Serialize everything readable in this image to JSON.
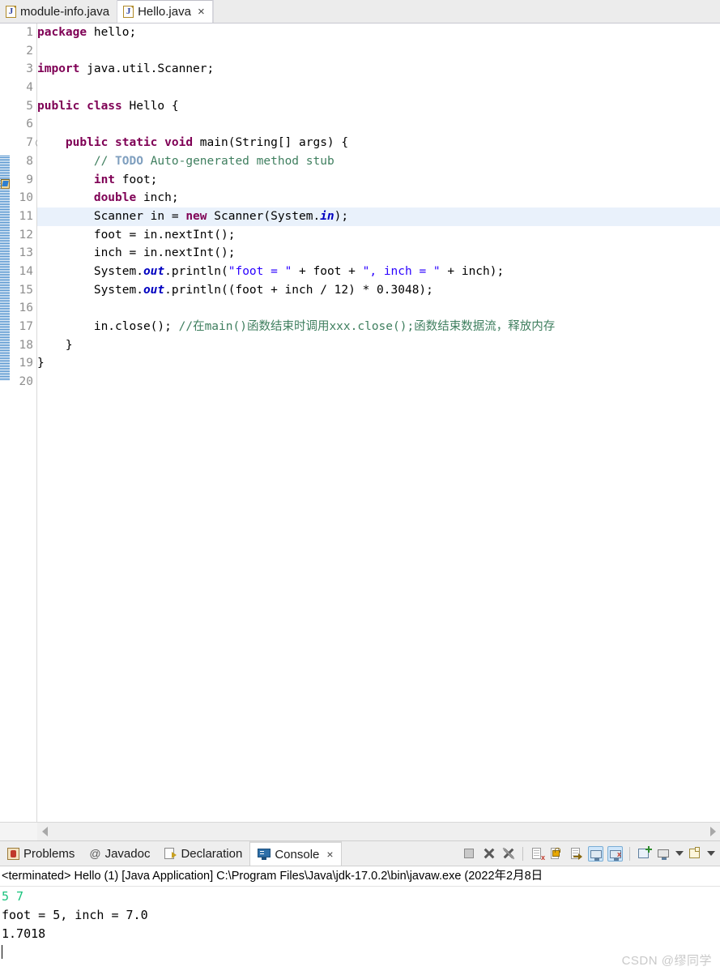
{
  "editor_tabs": [
    {
      "label": "module-info.java",
      "icon": "java-file-icon",
      "active": false,
      "closable": false
    },
    {
      "label": "Hello.java",
      "icon": "java-file-icon",
      "active": true,
      "closable": true,
      "close_glyph": "×"
    }
  ],
  "editor": {
    "highlighted_line": 11,
    "fold_line": 7,
    "todo_marker_line": 8,
    "line_numbers": [
      "1",
      "2",
      "3",
      "4",
      "5",
      "6",
      "7",
      "8",
      "9",
      "10",
      "11",
      "12",
      "13",
      "14",
      "15",
      "16",
      "17",
      "18",
      "19",
      "20"
    ],
    "lines": [
      {
        "n": "1",
        "tokens": [
          {
            "t": "package ",
            "c": "kw"
          },
          {
            "t": "hello;",
            "c": "pln"
          }
        ]
      },
      {
        "n": "2",
        "tokens": []
      },
      {
        "n": "3",
        "tokens": [
          {
            "t": "import ",
            "c": "kw"
          },
          {
            "t": "java.util.Scanner;",
            "c": "pln"
          }
        ]
      },
      {
        "n": "4",
        "tokens": []
      },
      {
        "n": "5",
        "tokens": [
          {
            "t": "public class ",
            "c": "kw"
          },
          {
            "t": "Hello {",
            "c": "pln"
          }
        ]
      },
      {
        "n": "6",
        "tokens": []
      },
      {
        "n": "7",
        "tokens": [
          {
            "t": "    ",
            "c": "pln"
          },
          {
            "t": "public static void ",
            "c": "kw"
          },
          {
            "t": "main(String[] args) {",
            "c": "pln"
          }
        ]
      },
      {
        "n": "8",
        "tokens": [
          {
            "t": "        ",
            "c": "pln"
          },
          {
            "t": "// ",
            "c": "cmt"
          },
          {
            "t": "TODO",
            "c": "todo"
          },
          {
            "t": " Auto-generated method stub",
            "c": "cmt"
          }
        ]
      },
      {
        "n": "9",
        "tokens": [
          {
            "t": "        ",
            "c": "pln"
          },
          {
            "t": "int ",
            "c": "kw"
          },
          {
            "t": "foot;",
            "c": "pln"
          }
        ]
      },
      {
        "n": "10",
        "tokens": [
          {
            "t": "        ",
            "c": "pln"
          },
          {
            "t": "double ",
            "c": "kw"
          },
          {
            "t": "inch;",
            "c": "pln"
          }
        ]
      },
      {
        "n": "11",
        "tokens": [
          {
            "t": "        Scanner in = ",
            "c": "pln"
          },
          {
            "t": "new ",
            "c": "kw"
          },
          {
            "t": "Scanner(System.",
            "c": "pln"
          },
          {
            "t": "in",
            "c": "fld"
          },
          {
            "t": ");",
            "c": "pln"
          }
        ]
      },
      {
        "n": "12",
        "tokens": [
          {
            "t": "        foot = in.nextInt();",
            "c": "pln"
          }
        ]
      },
      {
        "n": "13",
        "tokens": [
          {
            "t": "        inch = in.nextInt();",
            "c": "pln"
          }
        ]
      },
      {
        "n": "14",
        "tokens": [
          {
            "t": "        System.",
            "c": "pln"
          },
          {
            "t": "out",
            "c": "fld"
          },
          {
            "t": ".println(",
            "c": "pln"
          },
          {
            "t": "\"foot = \"",
            "c": "str"
          },
          {
            "t": " + foot + ",
            "c": "pln"
          },
          {
            "t": "\", inch = \"",
            "c": "str"
          },
          {
            "t": " + inch);",
            "c": "pln"
          }
        ]
      },
      {
        "n": "15",
        "tokens": [
          {
            "t": "        System.",
            "c": "pln"
          },
          {
            "t": "out",
            "c": "fld"
          },
          {
            "t": ".println((foot + inch / 12) * 0.3048);",
            "c": "pln"
          }
        ]
      },
      {
        "n": "16",
        "tokens": []
      },
      {
        "n": "17",
        "tokens": [
          {
            "t": "        in.close(); ",
            "c": "pln"
          },
          {
            "t": "//在main()函数结束时调用xxx.close();函数结束数据流，释放内存",
            "c": "cmt"
          }
        ]
      },
      {
        "n": "18",
        "tokens": [
          {
            "t": "    }",
            "c": "pln"
          }
        ]
      },
      {
        "n": "19",
        "tokens": [
          {
            "t": "}",
            "c": "pln"
          }
        ]
      },
      {
        "n": "20",
        "tokens": []
      }
    ]
  },
  "scrollbar": {
    "left_arrow": "scroll-left-arrow",
    "right_arrow": "scroll-right-arrow"
  },
  "panel_tabs": [
    {
      "label": "Problems",
      "icon": "problems-icon",
      "active": false,
      "closable": false
    },
    {
      "label": "Javadoc",
      "icon": "javadoc-at-icon",
      "active": false,
      "closable": false
    },
    {
      "label": "Declaration",
      "icon": "declaration-icon",
      "active": false,
      "closable": false
    },
    {
      "label": "Console",
      "icon": "console-icon",
      "active": true,
      "closable": true,
      "close_glyph": "×"
    }
  ],
  "panel_toolbar": [
    {
      "name": "terminate-button",
      "kind": "stop",
      "boxed": false
    },
    {
      "name": "remove-launch-button",
      "kind": "x",
      "boxed": false
    },
    {
      "name": "remove-all-terminated-button",
      "kind": "x-slash",
      "boxed": false
    },
    {
      "name": "separator-1",
      "kind": "sep",
      "boxed": false
    },
    {
      "name": "clear-console-button",
      "kind": "doc-x",
      "boxed": false
    },
    {
      "name": "scroll-lock-button",
      "kind": "lock",
      "boxed": false
    },
    {
      "name": "word-wrap-button",
      "kind": "doc-arrow",
      "boxed": false
    },
    {
      "name": "show-console-on-output-button",
      "kind": "console-std",
      "boxed": true
    },
    {
      "name": "show-console-on-error-button",
      "kind": "console-err",
      "boxed": true
    },
    {
      "name": "separator-2",
      "kind": "sep",
      "boxed": false
    },
    {
      "name": "pin-console-button",
      "kind": "pin",
      "boxed": false
    },
    {
      "name": "display-selected-console-button",
      "kind": "monitor",
      "boxed": false
    },
    {
      "name": "display-console-dropdown",
      "kind": "caret",
      "boxed": false
    },
    {
      "name": "open-console-button",
      "kind": "note",
      "boxed": false
    },
    {
      "name": "open-console-dropdown",
      "kind": "caret",
      "boxed": false
    }
  ],
  "console": {
    "header": "<terminated> Hello (1) [Java Application] C:\\Program Files\\Java\\jdk-17.0.2\\bin\\javaw.exe  (2022年2月8日",
    "lines": [
      {
        "text": "5 7",
        "kind": "input"
      },
      {
        "text": "foot = 5, inch = 7.0",
        "kind": "output"
      },
      {
        "text": "1.7018",
        "kind": "output"
      }
    ]
  },
  "watermark": "CSDN @缪同学",
  "colors": {
    "keyword": "#7f0055",
    "string": "#2a00ff",
    "comment": "#3f7f5f",
    "todo": "#7f9fbf",
    "field": "#0000c0",
    "line_highlight": "#e9f1fb",
    "console_input": "#19c37d",
    "annotation_bar": "#1a6fbf"
  }
}
